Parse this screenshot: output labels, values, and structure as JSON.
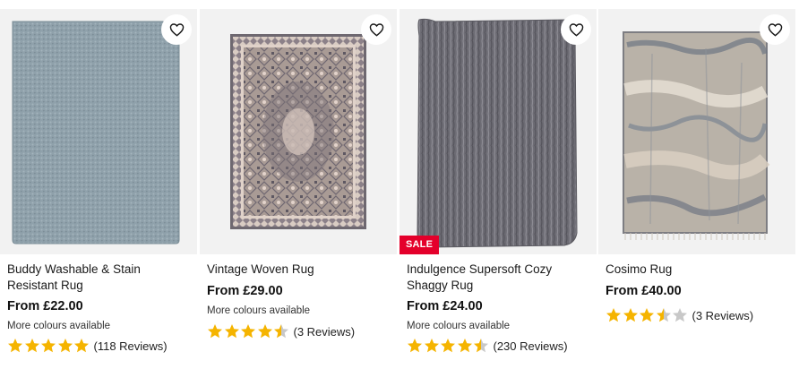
{
  "products": [
    {
      "title": "Buddy Washable & Stain Resistant Rug",
      "price": "From £22.00",
      "colours": "More colours available",
      "rating": 5,
      "reviews": "(118 Reviews)",
      "sale": "",
      "rug_color": "#8fa1ab",
      "favourite_icon": "heart-outline-icon"
    },
    {
      "title": "Vintage Woven Rug",
      "price": "From £29.00",
      "colours": "More colours available",
      "rating": 4.5,
      "reviews": "(3 Reviews)",
      "sale": "",
      "rug_color": "#b8aaa3",
      "favourite_icon": "heart-outline-icon"
    },
    {
      "title": "Indulgence Supersoft Cozy Shaggy Rug",
      "price": "From £24.00",
      "colours": "More colours available",
      "rating": 4.5,
      "reviews": "(230 Reviews)",
      "sale": "SALE",
      "rug_color": "#6d6c74",
      "favourite_icon": "heart-outline-icon"
    },
    {
      "title": "Cosimo Rug",
      "price": "From £40.00",
      "colours": "",
      "rating": 3.5,
      "reviews": "(3 Reviews)",
      "sale": "",
      "rug_color": "#b9b2a8",
      "favourite_icon": "heart-outline-icon"
    }
  ],
  "colors": {
    "star_filled": "#f5b400",
    "star_empty": "#c8c8c8",
    "sale_badge": "#e4002b"
  }
}
